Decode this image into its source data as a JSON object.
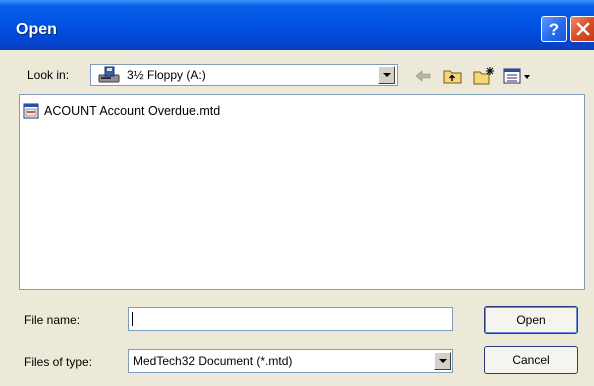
{
  "window": {
    "title": "Open"
  },
  "lookin": {
    "label": "Look in:",
    "value": "3½ Floppy (A:)"
  },
  "toolbar": {
    "icons": [
      "back-arrow-icon",
      "up-folder-icon",
      "new-folder-icon",
      "view-menu-icon"
    ]
  },
  "files": [
    {
      "name": "ACOUNT Account Overdue.mtd",
      "icon": "mtd-document-icon"
    }
  ],
  "filename": {
    "label": "File name:",
    "value": ""
  },
  "filetype": {
    "label": "Files of type:",
    "value": "MedTech32 Document (*.mtd)"
  },
  "buttons": {
    "open": "Open",
    "cancel": "Cancel"
  },
  "colors": {
    "titlebar": "#0054e3",
    "dialog_bg": "#ece9d8",
    "close": "#d8502a"
  }
}
